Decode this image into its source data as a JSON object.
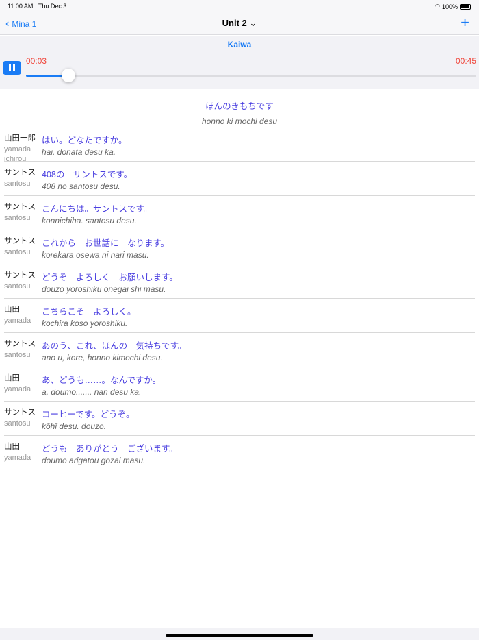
{
  "status": {
    "time": "11:00 AM",
    "date": "Thu Dec 3",
    "battery": "100%"
  },
  "nav": {
    "back_label": "Mina 1",
    "title": "Unit 2"
  },
  "player": {
    "section": "Kaiwa",
    "current": "00:03",
    "total": "00:45",
    "progress": 0.094
  },
  "header": {
    "jp": "ほんのきもちです",
    "romaji": "honno ki mochi desu"
  },
  "lines": [
    {
      "speaker": "山田一郎",
      "speaker_romaji": "yamada ichirou",
      "jp": "はい。どなたですか。",
      "romaji": "hai. donata desu ka."
    },
    {
      "speaker": "サントス",
      "speaker_romaji": "santosu",
      "jp": "408の　サントスです。",
      "romaji": "408 no santosu desu."
    },
    {
      "speaker": "サントス",
      "speaker_romaji": "santosu",
      "jp": "こんにちは。サントスです。",
      "romaji": "konnichiha. santosu desu."
    },
    {
      "speaker": "サントス",
      "speaker_romaji": "santosu",
      "jp": "これから　お世話に　なります。",
      "romaji": "korekara osewa ni nari masu."
    },
    {
      "speaker": "サントス",
      "speaker_romaji": "santosu",
      "jp": "どうぞ　よろしく　お願いします。",
      "romaji": "douzo yoroshiku onegai shi masu."
    },
    {
      "speaker": "山田",
      "speaker_romaji": "yamada",
      "jp": "こちらこそ　よろしく。",
      "romaji": "kochira koso yoroshiku."
    },
    {
      "speaker": "サントス",
      "speaker_romaji": "santosu",
      "jp": "あのう、これ、ほんの　気持ちです。",
      "romaji": "ano u, kore, honno kimochi desu."
    },
    {
      "speaker": "山田",
      "speaker_romaji": "yamada",
      "jp": "あ、どうも……。なんですか。",
      "romaji": "a, doumo....... nan desu ka."
    },
    {
      "speaker": "サントス",
      "speaker_romaji": "santosu",
      "jp": "コーヒーです。どうぞ。",
      "romaji": "kōhī desu. douzo."
    },
    {
      "speaker": "山田",
      "speaker_romaji": "yamada",
      "jp": "どうも　ありがとう　ございます。",
      "romaji": "doumo arigatou gozai masu."
    }
  ]
}
